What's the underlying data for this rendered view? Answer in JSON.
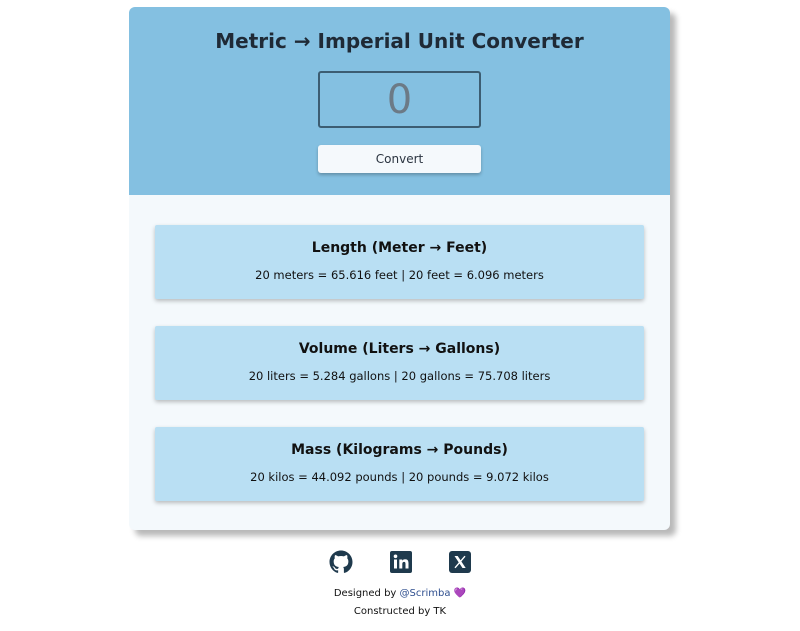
{
  "header": {
    "title": "Metric → Imperial Unit Converter",
    "input_value": "0",
    "convert_label": "Convert"
  },
  "results": [
    {
      "title": "Length (Meter → Feet)",
      "text": "20 meters = 65.616 feet | 20 feet = 6.096 meters"
    },
    {
      "title": "Volume (Liters → Gallons)",
      "text": "20 liters = 5.284 gallons | 20 gallons = 75.708 liters"
    },
    {
      "title": "Mass (Kilograms → Pounds)",
      "text": "20 kilos = 44.092 pounds | 20 pounds = 9.072 kilos"
    }
  ],
  "footer": {
    "socials": [
      "github-icon",
      "linkedin-icon",
      "x-icon"
    ],
    "designed_prefix": "Designed by",
    "designed_link": "@Scrimba",
    "heart": "💜",
    "constructed": "Constructed by TK"
  },
  "colors": {
    "header_bg": "#84c0e1",
    "result_bg": "#b9dff3",
    "icon": "#1f3a4d"
  }
}
